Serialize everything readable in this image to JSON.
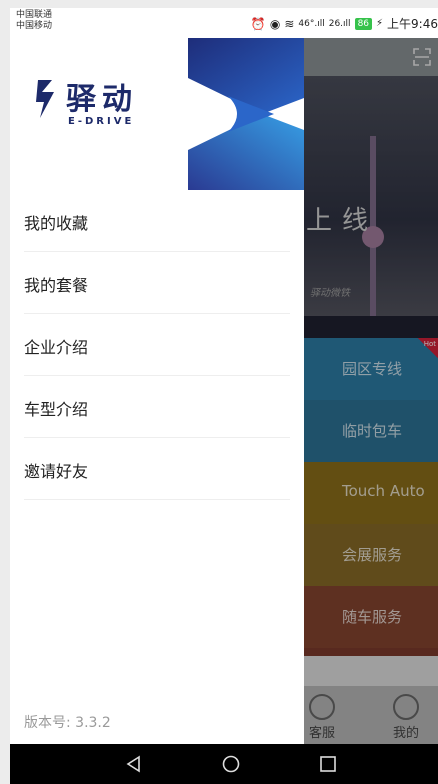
{
  "status_bar": {
    "carrier_1": "中国联通",
    "carrier_2": "中国移动",
    "signal_1": "46°.ıll",
    "signal_2": "26.ıll",
    "battery": "86",
    "time": "上午9:46"
  },
  "background_app": {
    "banner": {
      "heading": "上线",
      "subtext": "驿动微铁"
    },
    "tiles": [
      {
        "label": "园区专线",
        "color": "#2b7aa3"
      },
      {
        "label": "临时包车",
        "color": "#2c7193"
      },
      {
        "label": "Touch Auto",
        "color": "#8a6d1a"
      },
      {
        "label": "会展服务",
        "color": "#856826"
      },
      {
        "label": "随车服务",
        "color": "#83432e"
      }
    ],
    "hot_badge": "Hot",
    "bottom_nav": [
      {
        "label": "客服",
        "icon": "headset-icon"
      },
      {
        "label": "我的",
        "icon": "user-icon"
      }
    ]
  },
  "drawer": {
    "logo": {
      "name": "驿动",
      "subtitle": "E-DRIVE",
      "brand_color": "#1d2a6a",
      "accent_color": "#2b66c9"
    },
    "items": [
      {
        "label": "我的收藏"
      },
      {
        "label": "我的套餐"
      },
      {
        "label": "企业介绍"
      },
      {
        "label": "车型介绍"
      },
      {
        "label": "邀请好友"
      }
    ],
    "version": "版本号: 3.3.2"
  },
  "system_nav": [
    "back-icon",
    "home-icon",
    "recents-icon"
  ]
}
